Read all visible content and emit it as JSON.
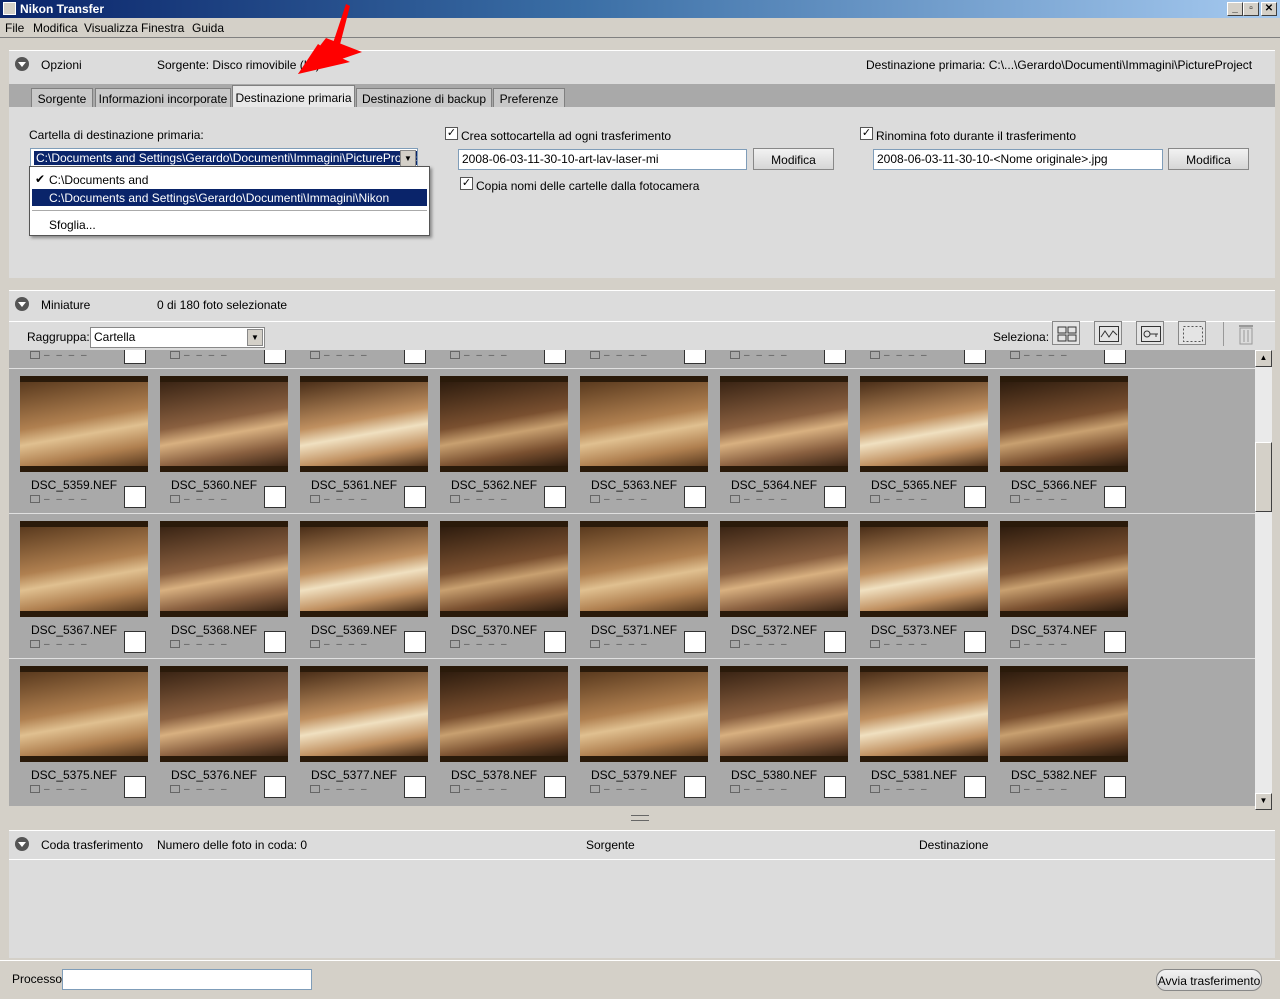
{
  "window": {
    "title": "Nikon Transfer"
  },
  "menu": [
    "File",
    "Modifica",
    "Visualizza",
    "Finestra",
    "Guida"
  ],
  "options": {
    "title": "Opzioni",
    "source": "Sorgente: Disco rimovibile (H:)",
    "destination": "Destinazione primaria: C:\\...\\Gerardo\\Documenti\\Immagini\\PictureProject",
    "tabs": [
      "Sorgente",
      "Informazioni incorporate",
      "Destinazione primaria",
      "Destinazione di backup",
      "Preferenze"
    ],
    "active_tab": 2,
    "folder_label": "Cartella di destinazione primaria:",
    "folder_value": "C:\\Documents and Settings\\Gerardo\\Documenti\\Immagini\\PictureProject",
    "dropdown": {
      "items": [
        "C:\\Documents and Settings\\Gerardo\\Documenti\\Immagini\\PictureProject",
        "C:\\Documents and Settings\\Gerardo\\Documenti\\Immagini\\Nikon Transfer"
      ],
      "checked_index": 0,
      "highlighted_index": 1,
      "browse": "Sfoglia..."
    },
    "subfolder": {
      "label": "Crea sottocartella ad ogni trasferimento",
      "checked": true,
      "value": "2008-06-03-11-30-10-art-lav-laser-mi",
      "button": "Modifica"
    },
    "copy_names": {
      "label": "Copia nomi delle cartelle dalla fotocamera",
      "checked": true
    },
    "rename": {
      "label": "Rinomina foto durante il trasferimento",
      "checked": true,
      "value": "2008-06-03-11-30-10-<Nome originale>.jpg",
      "button": "Modifica"
    }
  },
  "thumbnails": {
    "title": "Miniature",
    "count": "0 di 180 foto selezionate",
    "group_label": "Raggruppa:",
    "group_value": "Cartella",
    "select_label": "Seleziona:",
    "select_icons": [
      "grid-icon",
      "wave-icon",
      "key-icon",
      "marquee-icon"
    ],
    "rows": [
      [
        "DSC_5359.NEF",
        "DSC_5360.NEF",
        "DSC_5361.NEF",
        "DSC_5362.NEF",
        "DSC_5363.NEF",
        "DSC_5364.NEF",
        "DSC_5365.NEF",
        "DSC_5366.NEF"
      ],
      [
        "DSC_5367.NEF",
        "DSC_5368.NEF",
        "DSC_5369.NEF",
        "DSC_5370.NEF",
        "DSC_5371.NEF",
        "DSC_5372.NEF",
        "DSC_5373.NEF",
        "DSC_5374.NEF"
      ],
      [
        "DSC_5375.NEF",
        "DSC_5376.NEF",
        "DSC_5377.NEF",
        "DSC_5378.NEF",
        "DSC_5379.NEF",
        "DSC_5380.NEF",
        "DSC_5381.NEF",
        "DSC_5382.NEF"
      ]
    ],
    "meta_text": "– – – –"
  },
  "queue": {
    "title": "Coda trasferimento",
    "count": "Numero delle foto in coda: 0",
    "col_source": "Sorgente",
    "col_dest": "Destinazione"
  },
  "footer": {
    "process_label": "Processo:",
    "process_value": "",
    "start_button": "Avvia trasferimento"
  },
  "colors": {
    "title_gradient_start": "#0a246a",
    "selection": "#0a246a",
    "arrow": "#ff0000"
  }
}
